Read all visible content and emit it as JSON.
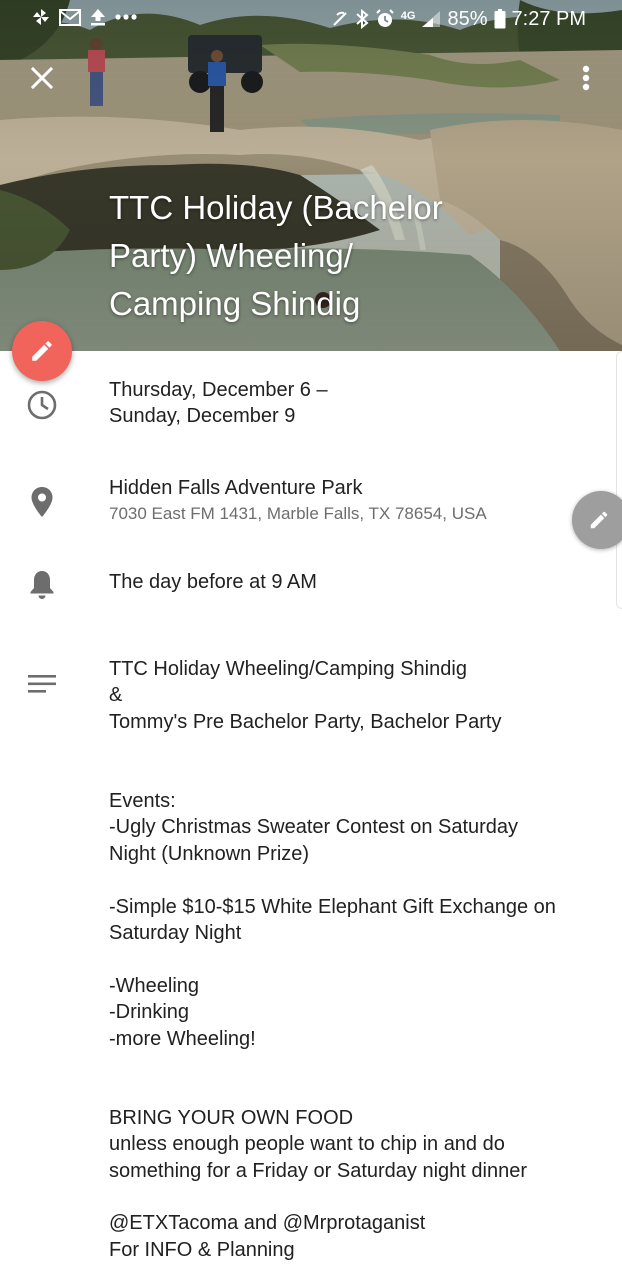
{
  "status_bar": {
    "battery": "85%",
    "time": "7:27 PM",
    "network": "4G",
    "left_icons": [
      "pinwheel-icon",
      "gmail-icon",
      "upload-icon",
      "more-dots-icon"
    ],
    "right_icons": [
      "no-signal-icon",
      "bluetooth-icon",
      "alarm-icon",
      "network-4g-icon",
      "signal-icon",
      "battery-icon"
    ]
  },
  "header": {
    "title": "TTC Holiday (Bachelor Party) Wheeling/ Camping Shindig",
    "title_lines": [
      "TTC Holiday (Bachelor",
      "Party) Wheeling/",
      "Camping Shindig"
    ],
    "close_icon": "close-icon",
    "menu_icon": "more-vert-icon"
  },
  "fab": {
    "icon": "edit-pencil-icon",
    "color": "#f0645b"
  },
  "edge_fab": {
    "icon": "edit-pencil-icon",
    "color": "#9e9e9e"
  },
  "date": {
    "icon": "clock-icon",
    "line1": "Thursday, December 6 –",
    "line2": "Sunday, December 9"
  },
  "location": {
    "icon": "location-pin-icon",
    "name": "Hidden Falls Adventure Park",
    "address": "7030 East FM 1431, Marble Falls, TX 78654, USA"
  },
  "reminder": {
    "icon": "bell-icon",
    "text": "The day before at 9 AM"
  },
  "description": {
    "icon": "notes-icon",
    "lines": [
      "TTC Holiday Wheeling/Camping Shindig",
      "&",
      "Tommy's Pre Bachelor Party, Bachelor Party",
      "",
      "",
      "Events:",
      "-Ugly Christmas Sweater Contest on Saturday",
      "Night (Unknown Prize)",
      "",
      "-Simple $10-$15 White Elephant Gift Exchange on",
      "Saturday Night",
      "",
      "-Wheeling",
      "-Drinking",
      "-more Wheeling!",
      "",
      "",
      "BRING YOUR OWN FOOD",
      "unless enough people want to chip in and do",
      "something for a Friday or Saturday night dinner",
      "",
      "@ETXTacoma and @Mrprotaganist",
      "For INFO & Planning"
    ]
  },
  "colors": {
    "icon_grey": "#6d6d6d",
    "text_primary": "#212121",
    "text_secondary": "#6d6d6d"
  }
}
